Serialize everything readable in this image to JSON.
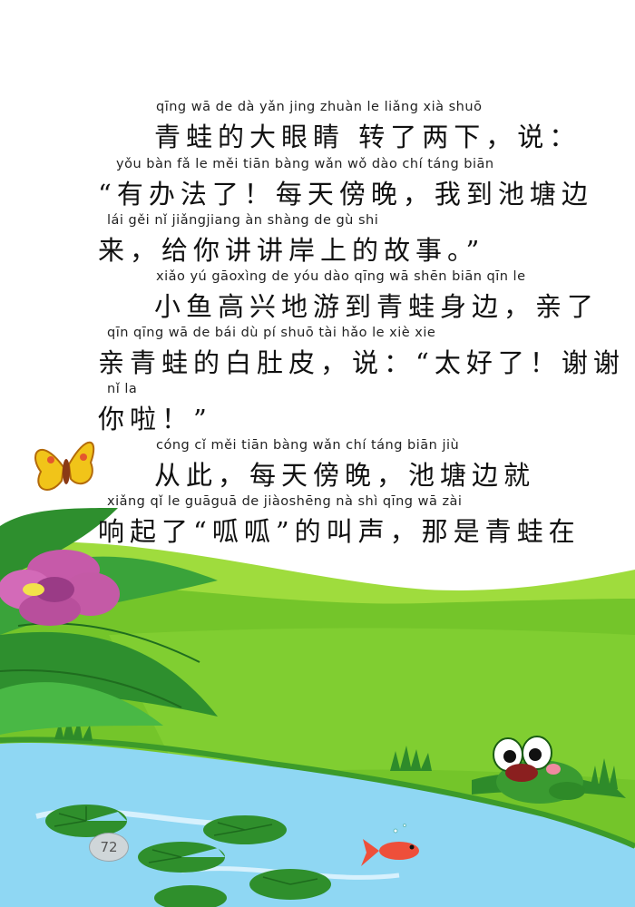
{
  "page": {
    "number": "72"
  },
  "lines": [
    {
      "pinyin": "qīng wā  de  dà  yǎn jing zhuàn  le  liǎng xià      shuō",
      "text": "青蛙的大眼睛 转了两下，说："
    },
    {
      "pinyin": "yǒu bàn  fǎ    le          měi tiān bàng wǎn       wǒ dào chí táng biān",
      "text": "“有办法了！每天傍晚，我到池塘边"
    },
    {
      "pinyin": "lái       gěi  nǐ  jiǎngjiang àn shàng de  gù  shi",
      "text": "来，给你讲讲岸上的故事。”"
    },
    {
      "pinyin": "xiǎo yú gāoxìng de  yóu dào qīng wā shēn biān      qīn   le",
      "text": "小鱼高兴地游到青蛙身边，亲了"
    },
    {
      "pinyin": "qīn qīng wā  de  bái  dù  pí      shuō        tài hǎo le        xiè xie",
      "text": "亲青蛙的白肚皮，说：“太好了！谢谢"
    },
    {
      "pinyin": "nǐ  la",
      "text": "你啦！”"
    },
    {
      "pinyin": "cóng  cǐ           měi tiān bàng wǎn           chí táng biān  jiù",
      "text": "从此，每天傍晚，池塘边就"
    },
    {
      "pinyin": "xiǎng  qǐ   le         guāguā   de jiàoshēng      nà  shì qīng wā  zài",
      "text": "响起了“呱呱”的叫声，那是青蛙在"
    }
  ]
}
